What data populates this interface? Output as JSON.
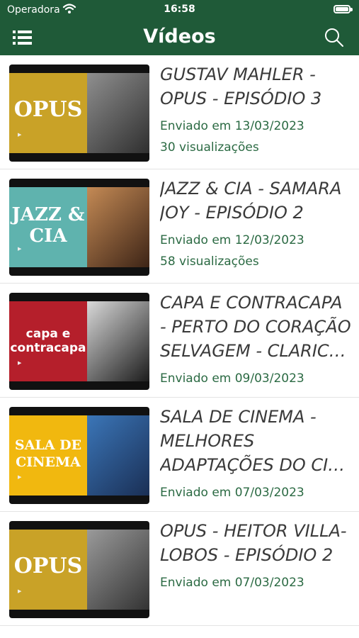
{
  "status_bar": {
    "carrier": "Operadora",
    "time": "16:58"
  },
  "nav": {
    "title": "Vídeos"
  },
  "videos": [
    {
      "title": "GUSTAV MAHLER - OPUS - EPISÓDIO 3",
      "date": "Enviado em 13/03/2023",
      "views": "30 visualizações",
      "thumb_text": "OPUS",
      "thumb_color": "#c9a227"
    },
    {
      "title": "JAZZ & CIA - SAMARA JOY - EPISÓDIO 2",
      "date": "Enviado em 12/03/2023",
      "views": "58 visualizações",
      "thumb_text": "JAZZ & CIA",
      "thumb_color": "#5fb3ae"
    },
    {
      "title": "CAPA E CONTRACAPA - PERTO DO CORAÇÃO SELVAGEM - CLARIC…",
      "date": "Enviado em 09/03/2023",
      "views": "",
      "thumb_text": "capa e contracapa",
      "thumb_color": "#b51f2b"
    },
    {
      "title": "SALA DE CINEMA - MELHORES ADAPTAÇÕES DO CI…",
      "date": "Enviado em 07/03/2023",
      "views": "",
      "thumb_text": "SALA DE CINEMA",
      "thumb_color": "#f1b80f"
    },
    {
      "title": "OPUS - HEITOR VILLA-LOBOS - EPISÓDIO 2",
      "date": "Enviado em 07/03/2023",
      "views": "",
      "thumb_text": "OPUS",
      "thumb_color": "#c9a227"
    }
  ]
}
